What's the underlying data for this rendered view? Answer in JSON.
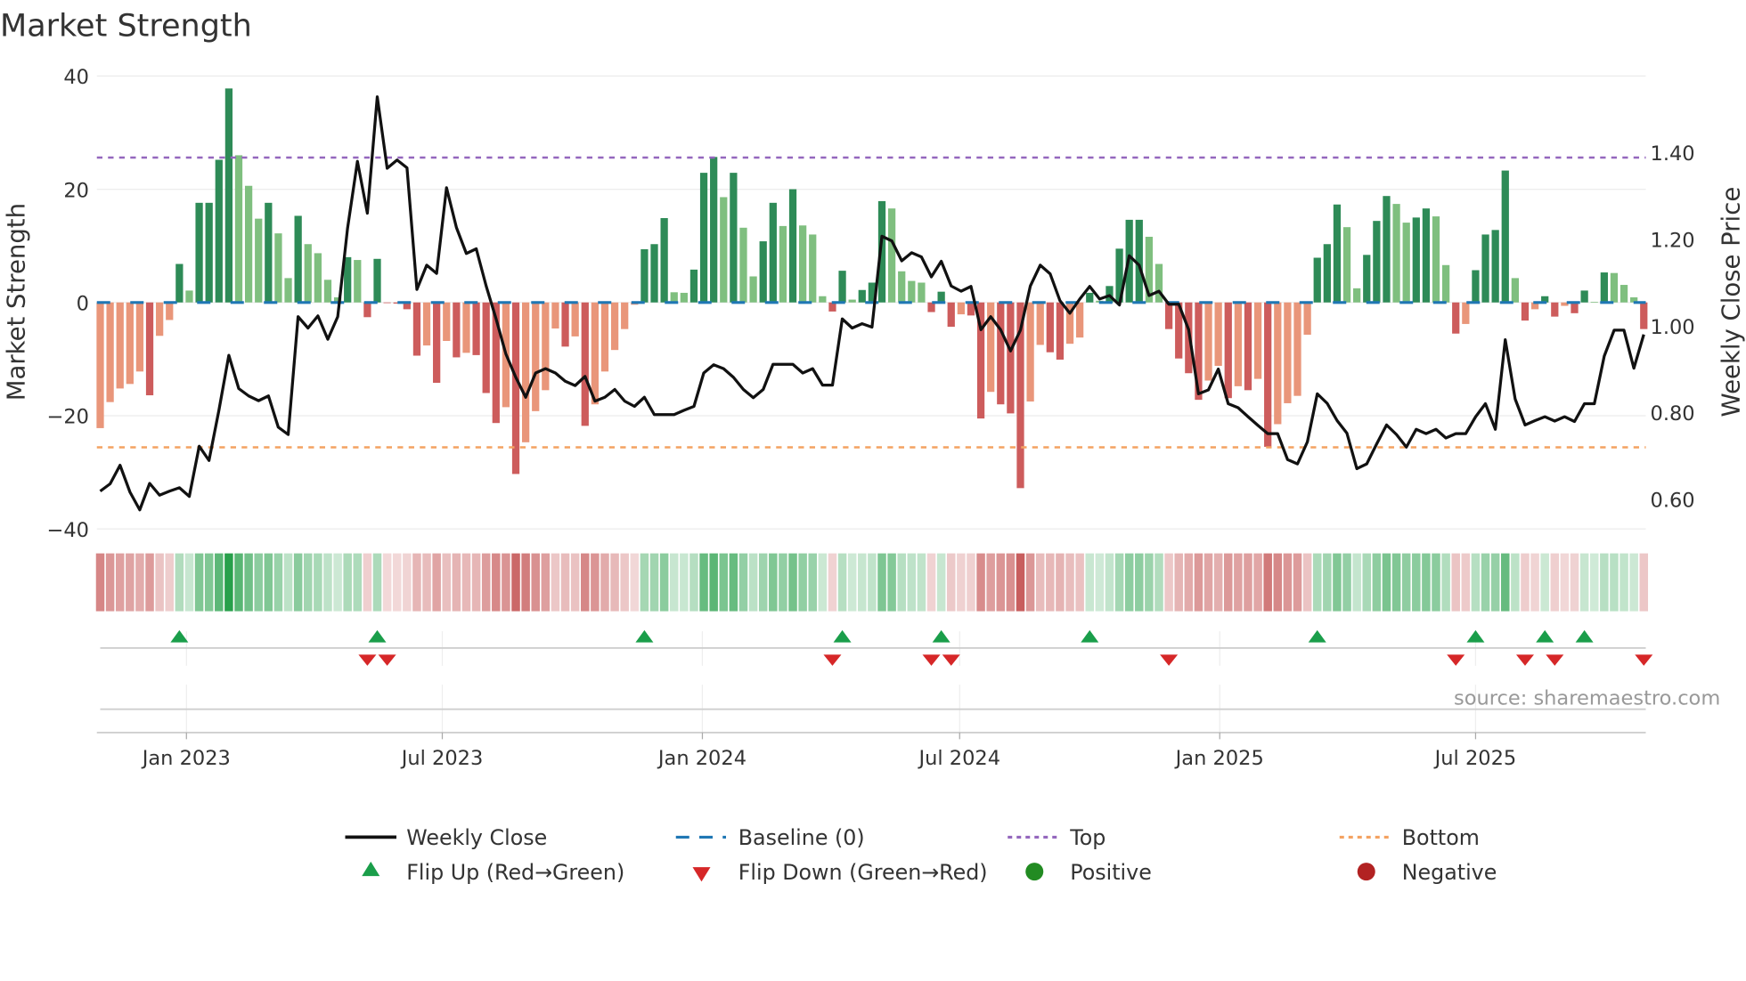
{
  "chart_data": {
    "type": "bar+line",
    "title": "Market Strength",
    "ylabel": "Market Strength",
    "y2label": "Weekly Close Price",
    "ylim": [
      -40,
      40
    ],
    "y2lim": [
      0.531,
      1.577
    ],
    "grid": true,
    "x_start": "2022-11-01",
    "x_freq": "weekly",
    "top_level": 25.6,
    "bottom_level": -25.6,
    "baseline": 0,
    "y_ticks": [
      {
        "value": 40,
        "label": "40"
      },
      {
        "value": 20,
        "label": "20"
      },
      {
        "value": 0,
        "label": "0"
      },
      {
        "value": -20,
        "label": "−20"
      },
      {
        "value": -40,
        "label": "−40"
      }
    ],
    "y2_ticks": [
      {
        "value": 1.4,
        "label": "1.40"
      },
      {
        "value": 1.2,
        "label": "1.20"
      },
      {
        "value": 1.0,
        "label": "1.00"
      },
      {
        "value": 0.8,
        "label": "0.80"
      },
      {
        "value": 0.6,
        "label": "0.60"
      }
    ],
    "x_ticks": [
      {
        "date": "2023-01-01",
        "label": "Jan 2023"
      },
      {
        "date": "2023-07-01",
        "label": "Jul 2023"
      },
      {
        "date": "2024-01-01",
        "label": "Jan 2024"
      },
      {
        "date": "2024-07-01",
        "label": "Jul 2024"
      },
      {
        "date": "2025-01-01",
        "label": "Jan 2025"
      },
      {
        "date": "2025-07-01",
        "label": "Jul 2025"
      }
    ],
    "strength": [
      -22.2,
      -17.6,
      -15.2,
      -14.4,
      -12.2,
      -16.4,
      -5.9,
      -3.1,
      6.8,
      2.1,
      17.6,
      17.6,
      25.2,
      37.8,
      26.0,
      20.6,
      14.8,
      17.6,
      12.2,
      4.3,
      15.3,
      10.3,
      8.7,
      4.0,
      0.9,
      8.0,
      7.5,
      -2.6,
      7.7,
      -0.1,
      -0.2,
      -1.2,
      -9.4,
      -7.6,
      -14.2,
      -6.8,
      -9.7,
      -8.9,
      -9.3,
      -16.0,
      -21.3,
      -18.5,
      -30.3,
      -24.7,
      -19.2,
      -15.5,
      -4.6,
      -7.8,
      -6.0,
      -21.8,
      -18.0,
      -12.2,
      -8.4,
      -4.7,
      -0.4,
      9.4,
      10.3,
      14.9,
      1.8,
      1.7,
      5.8,
      22.9,
      25.7,
      18.6,
      22.9,
      13.2,
      4.6,
      10.8,
      17.6,
      13.5,
      20.0,
      13.6,
      12.0,
      1.1,
      -1.6,
      5.6,
      0.5,
      2.2,
      3.5,
      17.9,
      16.6,
      5.5,
      3.8,
      3.5,
      -1.7,
      1.9,
      -4.3,
      -2.1,
      -2.3,
      -20.5,
      -15.8,
      -18.0,
      -19.6,
      -32.8,
      -17.5,
      -7.5,
      -8.8,
      -10.1,
      -7.3,
      -6.2,
      1.7,
      0.3,
      2.9,
      9.5,
      14.6,
      14.6,
      11.6,
      6.8,
      -4.7,
      -9.9,
      -12.5,
      -17.2,
      -13.8,
      -11.2,
      -16.9,
      -14.8,
      -15.5,
      -13.5,
      -25.5,
      -21.5,
      -17.8,
      -16.5,
      -5.7,
      7.9,
      10.3,
      17.3,
      13.3,
      2.5,
      8.4,
      14.4,
      18.8,
      17.4,
      14.1,
      15.0,
      16.6,
      15.2,
      6.6,
      -5.5,
      -3.8,
      5.7,
      12.0,
      12.8,
      23.3,
      4.3,
      -3.2,
      -1.2,
      1.1,
      -2.5,
      -0.6,
      -1.9,
      2.1,
      0.1,
      5.3,
      5.2,
      3.1,
      0.9,
      -4.7
    ],
    "close": [
      0.618,
      0.635,
      0.678,
      0.616,
      0.575,
      0.636,
      0.609,
      0.618,
      0.626,
      0.606,
      0.722,
      0.689,
      0.805,
      0.932,
      0.855,
      0.838,
      0.827,
      0.838,
      0.766,
      0.749,
      1.021,
      0.995,
      1.023,
      0.969,
      1.021,
      1.225,
      1.38,
      1.26,
      1.529,
      1.364,
      1.383,
      1.365,
      1.084,
      1.14,
      1.121,
      1.319,
      1.227,
      1.167,
      1.178,
      1.092,
      1.017,
      0.935,
      0.881,
      0.835,
      0.891,
      0.901,
      0.891,
      0.872,
      0.862,
      0.883,
      0.826,
      0.835,
      0.853,
      0.826,
      0.814,
      0.835,
      0.795,
      0.795,
      0.795,
      0.805,
      0.814,
      0.891,
      0.91,
      0.901,
      0.881,
      0.853,
      0.834,
      0.853,
      0.911,
      0.911,
      0.911,
      0.891,
      0.901,
      0.863,
      0.863,
      1.016,
      0.995,
      1.005,
      0.997,
      1.207,
      1.196,
      1.15,
      1.169,
      1.159,
      1.113,
      1.149,
      1.092,
      1.08,
      1.091,
      0.991,
      1.021,
      0.991,
      0.942,
      0.99,
      1.092,
      1.14,
      1.12,
      1.058,
      1.029,
      1.062,
      1.091,
      1.062,
      1.07,
      1.048,
      1.162,
      1.14,
      1.07,
      1.08,
      1.05,
      1.05,
      0.991,
      0.843,
      0.852,
      0.9,
      0.82,
      0.811,
      0.79,
      0.77,
      0.751,
      0.751,
      0.691,
      0.681,
      0.732,
      0.843,
      0.821,
      0.781,
      0.752,
      0.67,
      0.681,
      0.727,
      0.771,
      0.749,
      0.72,
      0.761,
      0.751,
      0.761,
      0.741,
      0.751,
      0.751,
      0.79,
      0.82,
      0.761,
      0.968,
      0.831,
      0.771,
      0.781,
      0.79,
      0.78,
      0.79,
      0.779,
      0.82,
      0.82,
      0.93,
      0.99,
      0.99,
      0.902,
      0.98
    ],
    "legend": {
      "placement": "bottom",
      "items": [
        {
          "key": "close",
          "label": "Weekly Close"
        },
        {
          "key": "baseline",
          "label": "Baseline (0)"
        },
        {
          "key": "top",
          "label": "Top"
        },
        {
          "key": "bottom",
          "label": "Bottom"
        },
        {
          "key": "flip_up",
          "label": "Flip Up (Red→Green)"
        },
        {
          "key": "flip_down",
          "label": "Flip Down (Green→Red)"
        },
        {
          "key": "positive",
          "label": "Positive"
        },
        {
          "key": "negative",
          "label": "Negative"
        }
      ]
    },
    "annotation": "source: sharemaestro.com",
    "colors": {
      "green_dark": "#2e8b57",
      "green_light": "#7fbf7f",
      "red_dark": "#cd5c5c",
      "red_light": "#e9967a",
      "close": "#111111",
      "baseline": "#1f77b4",
      "top": "#9467bd",
      "bottom": "#f4a261",
      "flip_up": "#1a9e4a",
      "flip_down": "#d62728",
      "positive": "#228b22",
      "negative": "#b22222"
    }
  }
}
